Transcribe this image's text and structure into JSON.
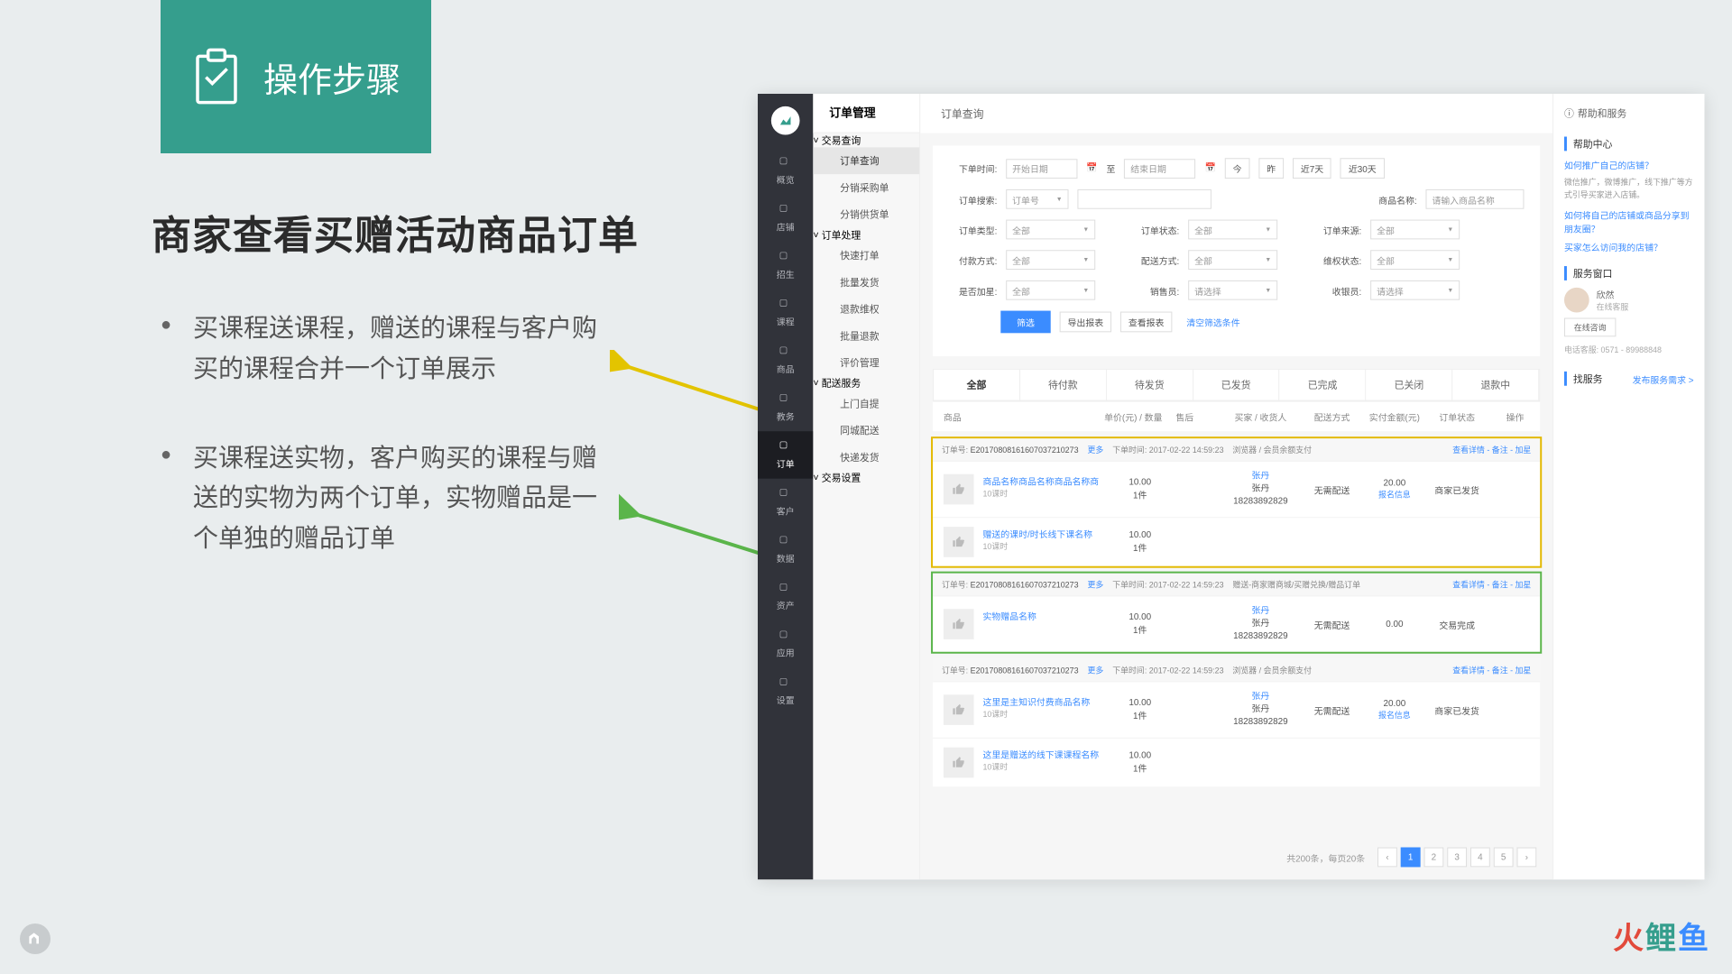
{
  "presentation": {
    "section_title": "操作步骤",
    "subtitle": "商家查看买赠活动商品订单",
    "bullets": [
      "买课程送课程，赠送的课程与客户购买的课程合并一个订单展示",
      "买课程送实物，客户购买的课程与赠送的实物为两个订单，实物赠品是一个单独的赠品订单"
    ],
    "brand": "火鲤鱼"
  },
  "sidebar_dark": {
    "items": [
      "概览",
      "店铺",
      "招生",
      "课程",
      "商品",
      "教务",
      "订单",
      "客户",
      "数据",
      "资产",
      "应用",
      "设置"
    ],
    "active": "订单"
  },
  "sidebar_light": {
    "header": "订单管理",
    "crumb": "订单查询",
    "groups": [
      {
        "title": "交易查询",
        "items": [
          "订单查询",
          "分销采购单",
          "分销供货单"
        ]
      },
      {
        "title": "订单处理",
        "items": [
          "快速打单",
          "批量发货",
          "退款维权",
          "批量退款",
          "评价管理"
        ]
      },
      {
        "title": "配送服务",
        "items": [
          "上门自提",
          "同城配送",
          "快递发货"
        ]
      },
      {
        "title": "交易设置",
        "items": []
      }
    ],
    "selected": "订单查询"
  },
  "filters": {
    "labels": {
      "time": "下单时间:",
      "from_ph": "开始日期",
      "to": "至",
      "to_ph": "结束日期",
      "today": "今",
      "yesterday": "昨",
      "week": "近7天",
      "month": "近30天",
      "search": "订单搜索:",
      "search_type": "订单号",
      "prod_name": "商品名称:",
      "prod_ph": "请输入商品名称",
      "order_type": "订单类型:",
      "order_status": "订单状态:",
      "order_source": "订单来源:",
      "pay_method": "付款方式:",
      "ship_method": "配送方式:",
      "rights_status": "维权状态:",
      "star": "是否加星:",
      "sales": "销售员:",
      "cashier": "收银员:",
      "all": "全部",
      "select_ph": "请选择",
      "filter_btn": "筛选",
      "export_btn": "导出报表",
      "view_report": "查看报表",
      "clear": "清空筛选条件"
    }
  },
  "tabs": [
    "全部",
    "待付款",
    "待发货",
    "已发货",
    "已完成",
    "已关闭",
    "退款中"
  ],
  "table_headers": {
    "goods": "商品",
    "price": "单价(元) / 数量",
    "after": "售后",
    "buyer": "买家 / 收货人",
    "ship": "配送方式",
    "amount": "实付金额(元)",
    "status": "订单状态",
    "op": "操作"
  },
  "orders": [
    {
      "highlight": "yellow",
      "no": "E20170808161607037210273",
      "more": "更多",
      "time_label": "下单时间:",
      "time": "2017-02-22 14:59:23",
      "channel": "浏览器 / 会员余额支付",
      "links": "查看详情 - 备注 - 加星",
      "rows": [
        {
          "name": "商品名称商品名称商品名称商",
          "sub": "10课时",
          "price": "10.00",
          "qty": "1件",
          "buyer": "张丹",
          "buyer2": "张丹",
          "phone": "18283892829",
          "ship": "无需配送",
          "amount": "20.00",
          "amount_sub": "报名信息",
          "status": "商家已发货"
        },
        {
          "name": "赠送的课时/时长线下课名称",
          "sub": "10课时",
          "price": "10.00",
          "qty": "1件"
        }
      ]
    },
    {
      "highlight": "green",
      "no": "E20170808161607037210273",
      "more": "更多",
      "time_label": "下单时间:",
      "time": "2017-02-22 14:59:23",
      "channel": "赠送-商家赠商城/买赠兑换/赠品订单",
      "links": "查看详情 - 备注 - 加星",
      "rows": [
        {
          "name": "实物赠品名称",
          "sub": "",
          "price": "10.00",
          "qty": "1件",
          "buyer": "张丹",
          "buyer2": "张丹",
          "phone": "18283892829",
          "ship": "无需配送",
          "amount": "0.00",
          "amount_sub": "",
          "status": "交易完成"
        }
      ]
    },
    {
      "highlight": "",
      "no": "E20170808161607037210273",
      "more": "更多",
      "time_label": "下单时间:",
      "time": "2017-02-22 14:59:23",
      "channel": "浏览器 / 会员余额支付",
      "links": "查看详情 - 备注 - 加星",
      "rows": [
        {
          "name": "这里是主知识付费商品名称",
          "sub": "10课时",
          "price": "10.00",
          "qty": "1件",
          "buyer": "张丹",
          "buyer2": "张丹",
          "phone": "18283892829",
          "ship": "无需配送",
          "amount": "20.00",
          "amount_sub": "报名信息",
          "status": "商家已发货"
        },
        {
          "name": "这里是赠送的线下课课程名称",
          "sub": "10课时",
          "price": "10.00",
          "qty": "1件"
        }
      ]
    }
  ],
  "pagination": {
    "info": "共200条，每页20条",
    "pages": [
      "1",
      "2",
      "3",
      "4",
      "5"
    ],
    "active": "1"
  },
  "right_panel": {
    "header": "帮助和服务",
    "help_center": "帮助中心",
    "q1": "如何推广自己的店铺？",
    "q1_text": "微信推广，微博推广，线下推广等方式引导买家进入店铺。",
    "q2": "如何将自己的店铺或商品分享到朋友圈？",
    "q3": "买家怎么访问我的店铺？",
    "service_window": "服务窗口",
    "agent_name": "欣然",
    "agent_role": "在线客服",
    "consult": "在线咨询",
    "hotline": "电话客服: 0571 - 89988848",
    "find_service": "找服务",
    "publish": "发布服务需求 >"
  }
}
